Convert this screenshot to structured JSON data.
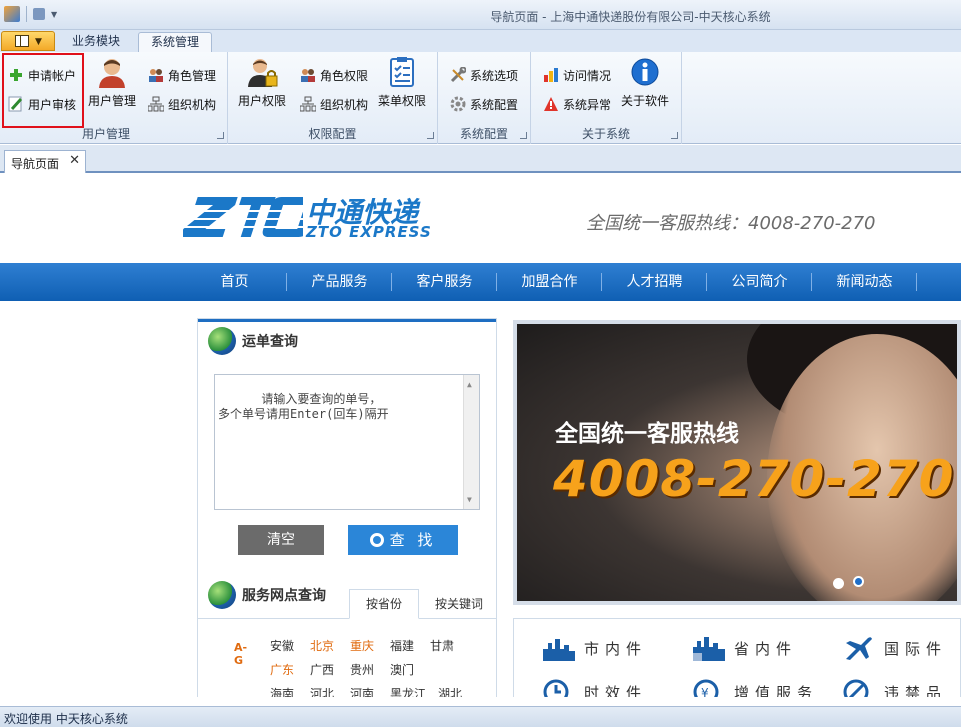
{
  "window": {
    "title": "导航页面 - 上海中通快递股份有限公司-中天核心系统"
  },
  "ribbon_tabs": [
    "业务模块",
    "系统管理"
  ],
  "ribbon": {
    "groups": [
      {
        "label": "用户管理",
        "small": [
          "申请帐户",
          "用户审核"
        ],
        "big": "用户管理",
        "small2": [
          "角色管理",
          "组织机构"
        ]
      },
      {
        "label": "权限配置",
        "big": "用户权限",
        "small": [
          "角色权限",
          "组织机构"
        ],
        "big2": "菜单权限"
      },
      {
        "label": "系统配置",
        "small": [
          "系统选项",
          "系统配置"
        ]
      },
      {
        "label": "关于系统",
        "small": [
          "访问情况",
          "系统异常"
        ],
        "big": "关于软件"
      }
    ]
  },
  "doc_tab": {
    "label": "导航页面",
    "close": "✕"
  },
  "site": {
    "brand_cn": "中通快递",
    "brand_en": "ZTO EXPRESS",
    "hotline": "全国统一客服热线：4008-270-270",
    "nav": [
      "首页",
      "产品服务",
      "客户服务",
      "加盟合作",
      "人才招聘",
      "公司简介",
      "新闻动态"
    ],
    "tracking": {
      "title": "运单查询",
      "placeholder": "请输入要查询的单号，\n多个单号请用Enter(回车)隔开",
      "clear": "清空",
      "find": "查 找"
    },
    "outlets": {
      "title": "服务网点查询",
      "tabs": [
        "按省份",
        "按关键词"
      ],
      "az": "A-G",
      "provinces_row1": [
        "安徽",
        "北京",
        "重庆",
        "福建",
        "甘肃"
      ],
      "provinces_row2": [
        "广东",
        "广西",
        "贵州",
        "澳门"
      ],
      "provinces_row3": [
        "海南",
        "河北",
        "河南",
        "黑龙江",
        "湖北"
      ]
    },
    "banner": {
      "line1": "全国统一客服热线",
      "line2": "4008-270-270"
    },
    "services": [
      "市内件",
      "省内件",
      "国际件",
      "时效件",
      "增值服务",
      "违禁品"
    ]
  },
  "status": "欢迎使用 中天核心系统",
  "colors": {
    "accent": "#1e6ec2",
    "highlight_box": "#e0101a",
    "banner_number": "#f7a21b"
  }
}
